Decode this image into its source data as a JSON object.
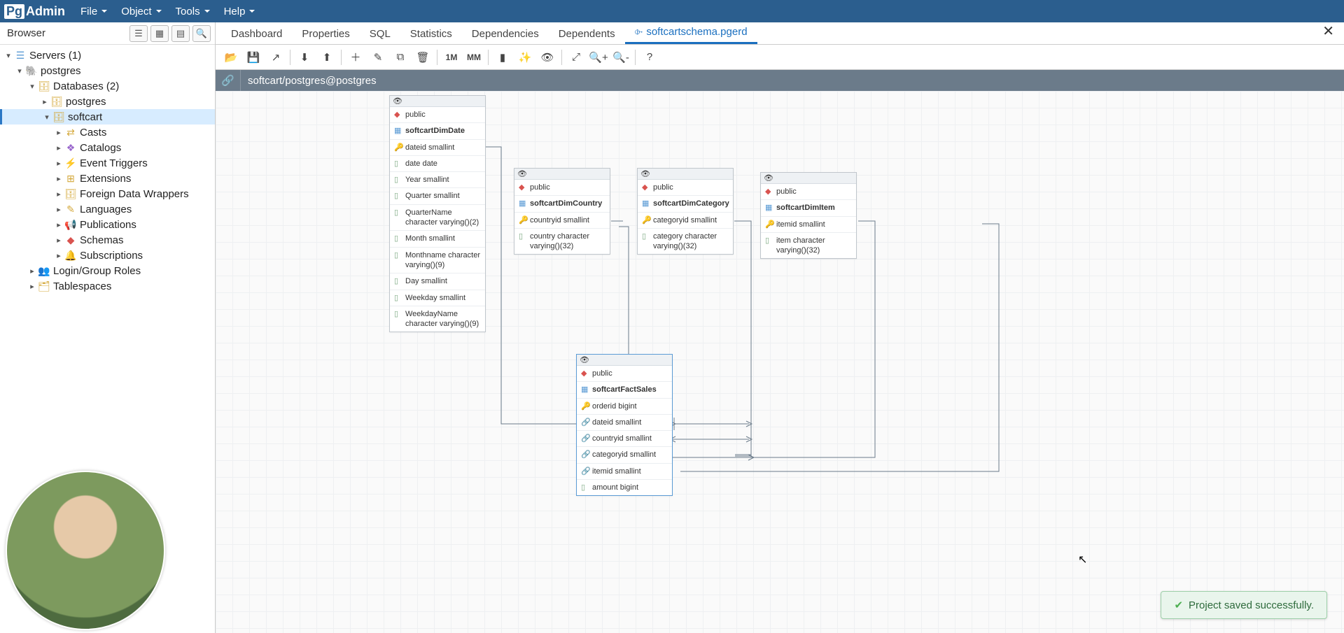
{
  "app": {
    "logo_pg": "Pg",
    "logo_admin": "Admin"
  },
  "menu": [
    "File",
    "Object",
    "Tools",
    "Help"
  ],
  "browser": {
    "title": "Browser",
    "servers": "Servers (1)",
    "postgres_server": "postgres",
    "databases": "Databases (2)",
    "db_postgres": "postgres",
    "db_softcart": "softcart",
    "items": [
      "Casts",
      "Catalogs",
      "Event Triggers",
      "Extensions",
      "Foreign Data Wrappers",
      "Languages",
      "Publications",
      "Schemas",
      "Subscriptions"
    ],
    "login_roles": "Login/Group Roles",
    "tablespaces": "Tablespaces"
  },
  "tabs": [
    "Dashboard",
    "Properties",
    "SQL",
    "Statistics",
    "Dependencies",
    "Dependents"
  ],
  "active_tab": "softcartschema.pgerd",
  "conn": "softcart/postgres@postgres",
  "toolbar_labels": {
    "onemany": "1M",
    "manymany": "MM"
  },
  "entities": {
    "dimdate": {
      "schema": "public",
      "table": "softcartDimDate",
      "cols": [
        {
          "t": "k",
          "n": "dateid smallint"
        },
        {
          "t": "c",
          "n": "date date"
        },
        {
          "t": "c",
          "n": "Year smallint"
        },
        {
          "t": "c",
          "n": "Quarter smallint"
        },
        {
          "t": "c",
          "n": "QuarterName character varying()(2)"
        },
        {
          "t": "c",
          "n": "Month smallint"
        },
        {
          "t": "c",
          "n": "Monthname character varying()(9)"
        },
        {
          "t": "c",
          "n": "Day smallint"
        },
        {
          "t": "c",
          "n": "Weekday smallint"
        },
        {
          "t": "c",
          "n": "WeekdayName character varying()(9)"
        }
      ]
    },
    "dimcountry": {
      "schema": "public",
      "table": "softcartDimCountry",
      "cols": [
        {
          "t": "k",
          "n": "countryid smallint"
        },
        {
          "t": "c",
          "n": "country character varying()(32)"
        }
      ]
    },
    "dimcategory": {
      "schema": "public",
      "table": "softcartDimCategory",
      "cols": [
        {
          "t": "k",
          "n": "categoryid smallint"
        },
        {
          "t": "c",
          "n": "category character varying()(32)"
        }
      ]
    },
    "dimitem": {
      "schema": "public",
      "table": "softcartDimItem",
      "cols": [
        {
          "t": "k",
          "n": "itemid smallint"
        },
        {
          "t": "c",
          "n": "item character varying()(32)"
        }
      ]
    },
    "factsales": {
      "schema": "public",
      "table": "softcartFactSales",
      "cols": [
        {
          "t": "k",
          "n": "orderid bigint"
        },
        {
          "t": "f",
          "n": "dateid smallint"
        },
        {
          "t": "f",
          "n": "countryid smallint"
        },
        {
          "t": "f",
          "n": "categoryid smallint"
        },
        {
          "t": "f",
          "n": "itemid smallint"
        },
        {
          "t": "c",
          "n": "amount bigint"
        }
      ]
    }
  },
  "toast": "Project saved successfully."
}
